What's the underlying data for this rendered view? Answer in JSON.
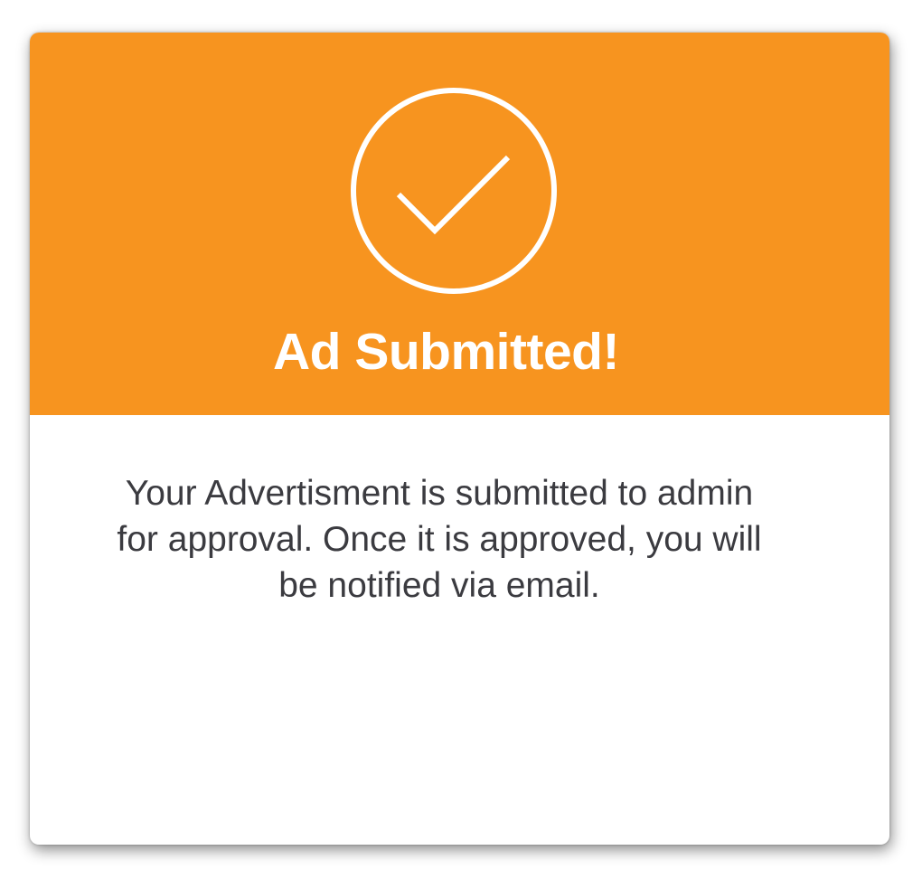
{
  "dialog": {
    "icon": "checkmark-circle-icon",
    "title": "Ad Submitted!",
    "message": "Your Advertisment is submitted to admin for approval. Once it is approved, you will be notified via email."
  },
  "colors": {
    "header_background": "#f7941f",
    "title_text": "#ffffff",
    "message_text": "#3b3b40",
    "body_background": "#ffffff"
  }
}
